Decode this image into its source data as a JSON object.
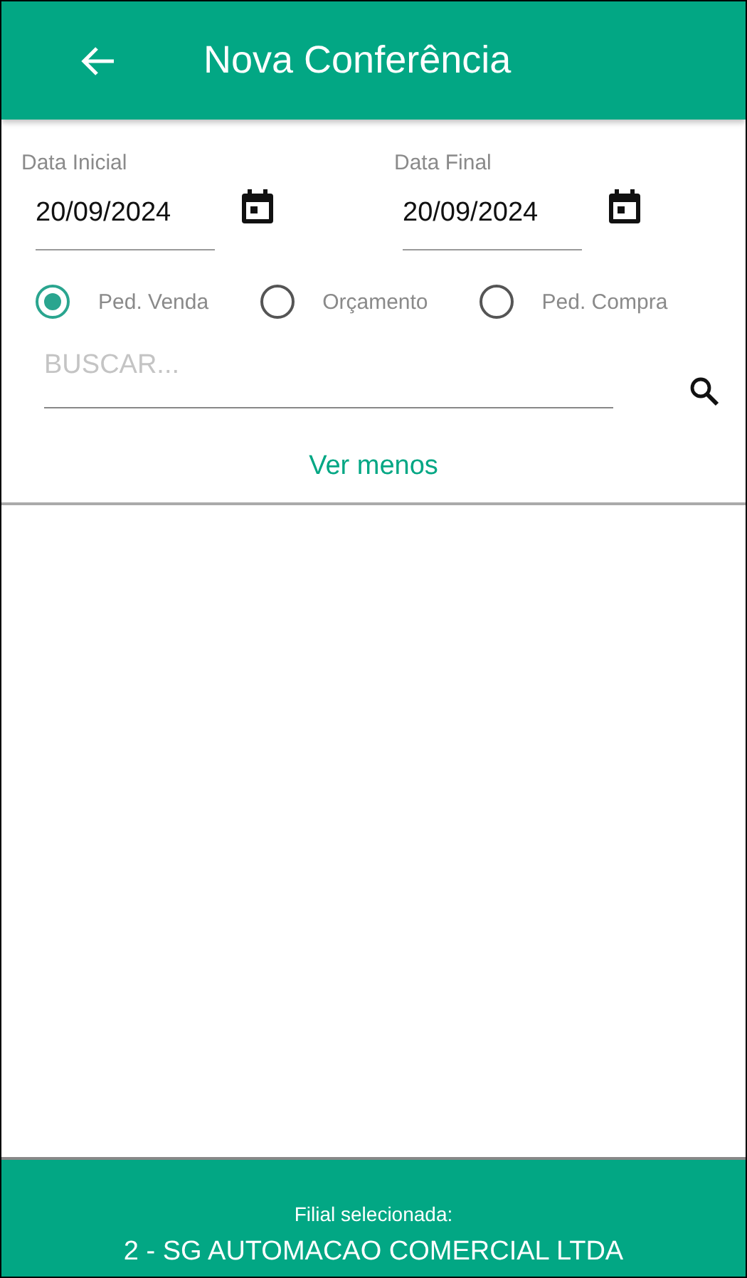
{
  "header": {
    "title": "Nova Conferência"
  },
  "dates": [
    {
      "label": "Data Inicial",
      "value": "20/09/2024"
    },
    {
      "label": "Data Final",
      "value": "20/09/2024"
    }
  ],
  "order_types": [
    {
      "label": "Ped. Venda",
      "selected": true
    },
    {
      "label": "Orçamento",
      "selected": false
    },
    {
      "label": "Ped. Compra",
      "selected": false
    }
  ],
  "search": {
    "placeholder": "BUSCAR..."
  },
  "toggle_link": "Ver menos",
  "footer": {
    "caption": "Filial selecionada:",
    "branch": "2 - SG AUTOMACAO COMERCIAL LTDA"
  }
}
